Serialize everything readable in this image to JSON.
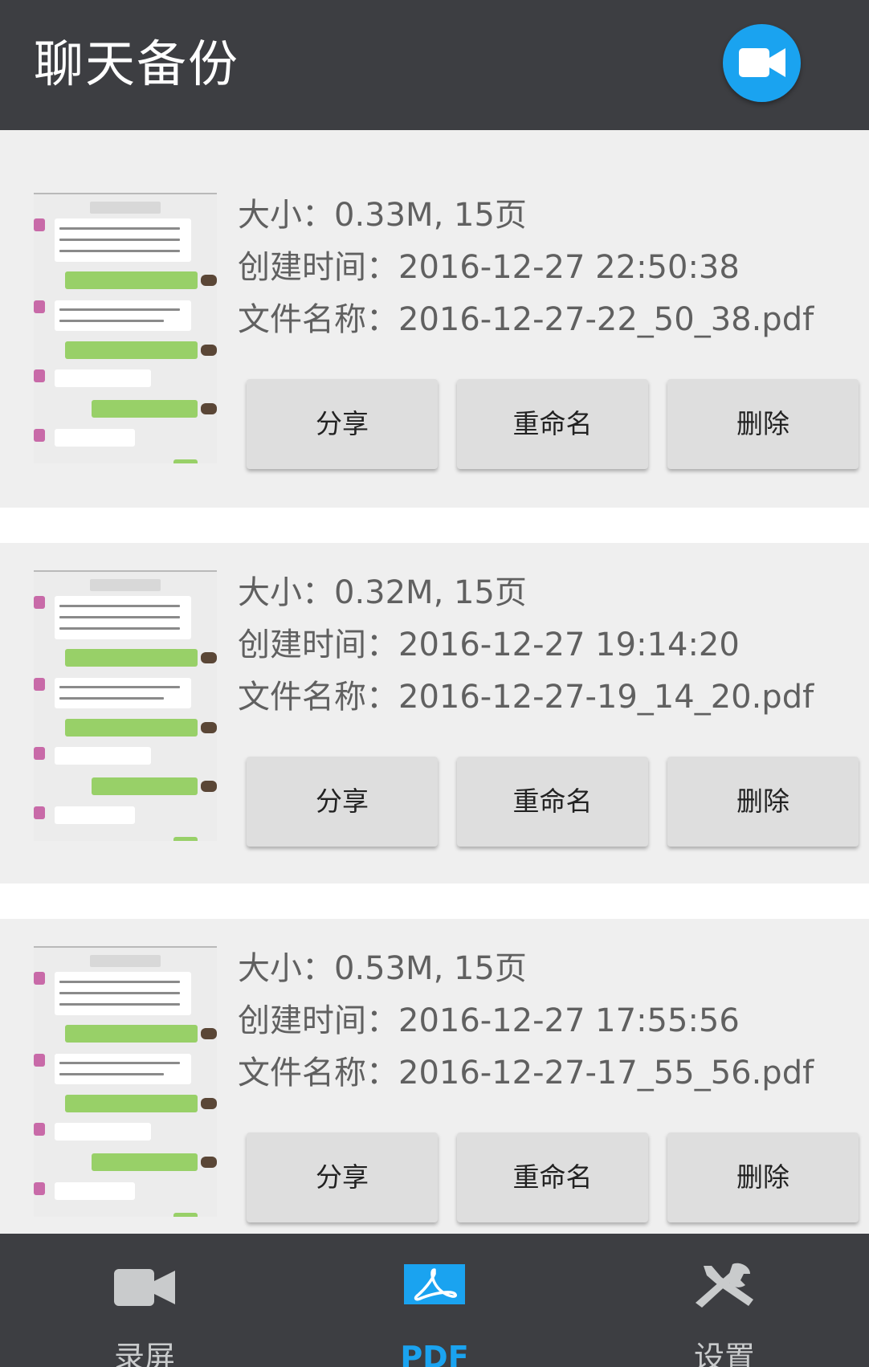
{
  "app_title": "聊天备份",
  "header": {
    "record_icon": "video-camera-icon",
    "accent": "#1aa3f0",
    "bar_color": "#3d3e42"
  },
  "buttons": {
    "share": "分享",
    "rename": "重命名",
    "delete": "删除"
  },
  "files": [
    {
      "size_line": "大小：0.33M, 15页",
      "created_line": "创建时间：2016-12-27 22:50:38",
      "name_line": "文件名称：2016-12-27-22_50_38.pdf"
    },
    {
      "size_line": "大小：0.32M, 15页",
      "created_line": "创建时间：2016-12-27 19:14:20",
      "name_line": "文件名称：2016-12-27-19_14_20.pdf"
    },
    {
      "size_line": "大小：0.53M, 15页",
      "created_line": "创建时间：2016-12-27 17:55:56",
      "name_line": "文件名称：2016-12-27-17_55_56.pdf"
    }
  ],
  "nav": [
    {
      "label": "录屏",
      "icon": "video-camera-icon",
      "active": false
    },
    {
      "label": "PDF",
      "icon": "pdf-icon",
      "active": true
    },
    {
      "label": "设置",
      "icon": "tools-icon",
      "active": false
    }
  ]
}
